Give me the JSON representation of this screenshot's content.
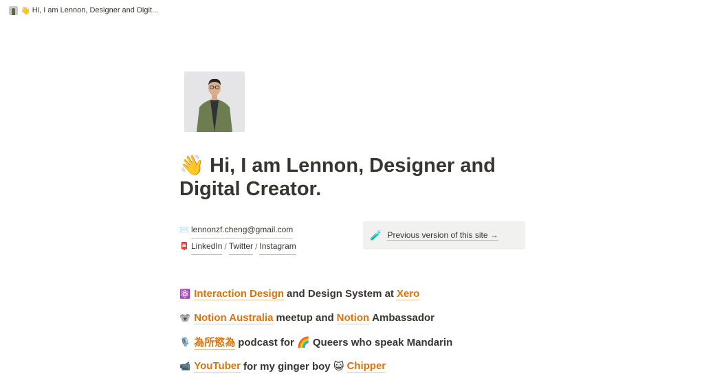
{
  "tab": {
    "favicon": "profile-photo-icon",
    "emoji": "👋",
    "title": "Hi, I am Lennon, Designer and Digit..."
  },
  "header": {
    "emoji": "👋",
    "title_line": "Hi, I am Lennon, Designer and Digital Creator."
  },
  "contacts": {
    "email_icon": "✉️",
    "email": "lennonzf.cheng@gmail.com",
    "social_icon": "📮",
    "linkedin": "LinkedIn",
    "twitter": "Twitter",
    "instagram": "Instagram",
    "separator": "/"
  },
  "callout": {
    "icon": "🧪",
    "text": "Previous version of this site →"
  },
  "bullets": [
    {
      "icon": "⚛️",
      "link1": "Interaction Design",
      "text1": "and Design System at",
      "link2": "Xero",
      "text2": ""
    },
    {
      "icon": "🐨",
      "link1": "Notion Australia",
      "text1": "meetup and",
      "link2": "Notion",
      "text2": "Ambassador"
    },
    {
      "icon": "🎙️",
      "link1": "為所慾為",
      "text1": "podcast for 🌈 Queers who speak Mandarin",
      "link2": "",
      "text2": ""
    },
    {
      "icon": "📹",
      "link1": "YouTuber",
      "text1": "for my ginger boy 😺",
      "link2": "Chipper",
      "text2": ""
    }
  ],
  "colors": {
    "text": "#37352f",
    "link_orange": "#d9730d",
    "callout_bg": "#f1f1ef"
  }
}
